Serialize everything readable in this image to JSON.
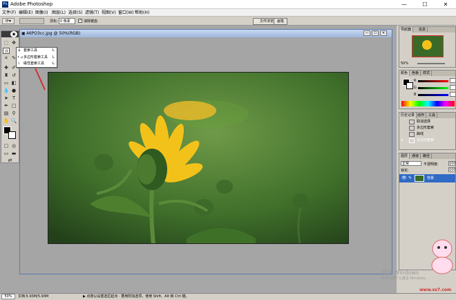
{
  "app": {
    "title": "Adobe Photoshop",
    "logo_text": "Ps"
  },
  "window_controls": {
    "minimize": "—",
    "maximize": "☐",
    "close": "✕"
  },
  "menu": [
    "文件(F)",
    "编辑(E)",
    "图像(I)",
    "图层(L)",
    "选择(S)",
    "滤镜(T)",
    "视图(V)",
    "窗口(W)",
    "帮助(H)"
  ],
  "options": {
    "feather_label": "羽化:",
    "feather_value": "0 像素",
    "antialias_label": "消除锯齿"
  },
  "panel_well": {
    "tab1": "文件浏览",
    "tab2": "画笔"
  },
  "document": {
    "title": "46PO3cc.jpg @ 50%(RGB)"
  },
  "flyout": {
    "items": [
      {
        "label": "套索工具",
        "shortcut": "L"
      },
      {
        "label": "多边形套索工具",
        "shortcut": "L"
      },
      {
        "label": "磁性套索工具",
        "shortcut": "L"
      }
    ]
  },
  "navigator": {
    "tabs": [
      "导航器",
      "信息"
    ],
    "zoom": "50%"
  },
  "color": {
    "tabs": [
      "颜色",
      "色板",
      "样式"
    ],
    "channels": [
      "R",
      "G",
      "B"
    ],
    "values": [
      "",
      "",
      ""
    ]
  },
  "history": {
    "tabs": [
      "历史记录",
      "动作",
      "工具"
    ],
    "items": [
      "取消选择",
      "多边形套索",
      "曲线",
      "多边形套索"
    ],
    "active_index": 3
  },
  "layers": {
    "tabs": [
      "图层",
      "通道",
      "路径"
    ],
    "blend_mode": "正常",
    "opacity_label": "不透明度:",
    "opacity": "100",
    "lock_label": "锁定:",
    "fill_value": "100",
    "layer_name": "背景"
  },
  "status": {
    "zoom": "50%",
    "doc_size": "文档:5.93M/5.93M",
    "hint": "▶ 点按以设置选区起点 · 要用附加选项，使用 Shift、Alt 和 Ctrl 键。"
  },
  "watermark": {
    "text1": "激活 Windows",
    "text2": "转到\"设置\"以激活 Windows。",
    "site": "www.xz7.com"
  },
  "colors": {
    "accent": "#0a246a",
    "history_active": "#316ac5",
    "layer_active": "#316ac5",
    "arrow": "#d03030"
  }
}
